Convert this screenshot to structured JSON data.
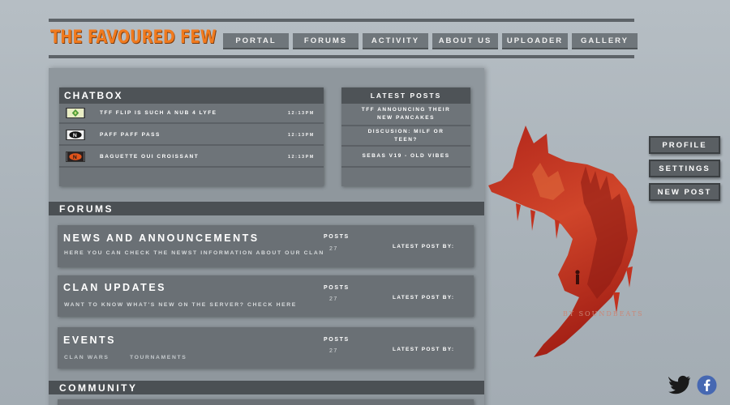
{
  "header": {
    "title": "THE FAVOURED FEW",
    "nav": [
      "PORTAL",
      "FORUMS",
      "ACTIVITY",
      "ABOUT US",
      "UPLOADER",
      "GALLERY"
    ]
  },
  "chatbox": {
    "title": "CHATBOX",
    "messages": [
      {
        "text": "TFF FLIP IS SUCH A NUB 4 LYFE",
        "time": "12:13PM",
        "avatar": "green-diamond-logo-icon"
      },
      {
        "text": "PAFF PAFF PASS",
        "time": "12:13PM",
        "avatar": "black-n-logo-icon"
      },
      {
        "text": "BAGUETTE OUI CROISSANT",
        "time": "12:13PM",
        "avatar": "orange-n-logo-icon"
      }
    ]
  },
  "latest_posts": {
    "title": "LATEST POSTS",
    "items": [
      "TFF ANNOUNCING THEIR NEW PANCAKES",
      "DISCUSION: MILF OR TEEN?",
      "SEBAS V19 - OLD VIBES"
    ]
  },
  "sections": {
    "forums": "FORUMS",
    "community": "COMMUNITY"
  },
  "forums": [
    {
      "title": "NEWS AND ANNOUNCEMENTS",
      "desc": "HERE YOU CAN CHECK THE NEWST INFORMATION ABOUT OUR CLAN",
      "posts_label": "POSTS",
      "posts": "27",
      "latest_label": "LATEST POST BY:"
    },
    {
      "title": "CLAN UPDATES",
      "desc": "WANT TO KNOW WHAT'S NEW ON THE SERVER? CHECK HERE",
      "posts_label": "POSTS",
      "posts": "27",
      "latest_label": "LATEST POST BY:"
    },
    {
      "title": "EVENTS",
      "sub": [
        "CLAN WARS",
        "TOURNAMENTS"
      ],
      "posts_label": "POSTS",
      "posts": "27",
      "latest_label": "LATEST POST BY:"
    }
  ],
  "side_menu": [
    "PROFILE",
    "SETTINGS",
    "NEW POST"
  ],
  "credit": "BY SOUNDBEATS",
  "social": [
    "twitter-icon",
    "facebook-icon"
  ],
  "colors": {
    "brand": "#f07a1e",
    "panel": "#6e7479",
    "bar": "#4b5054",
    "fox": "#c0301c"
  }
}
